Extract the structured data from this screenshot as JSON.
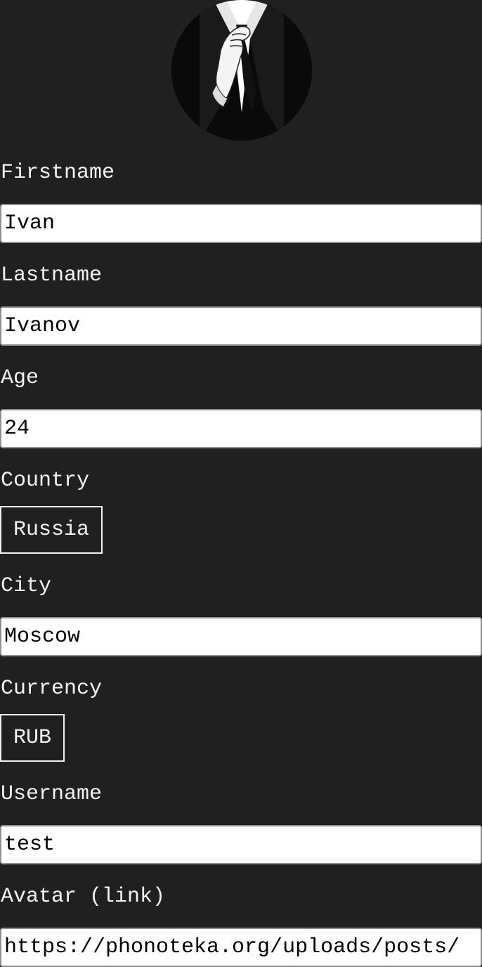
{
  "profile": {
    "avatar_icon": "anonymous-suit-avatar",
    "fields": {
      "firstname": {
        "label": "Firstname",
        "value": "Ivan"
      },
      "lastname": {
        "label": "Lastname",
        "value": "Ivanov"
      },
      "age": {
        "label": "Age",
        "value": "24"
      },
      "country": {
        "label": "Country",
        "value": "Russia"
      },
      "city": {
        "label": "City",
        "value": "Moscow"
      },
      "currency": {
        "label": "Currency",
        "value": "RUB"
      },
      "username": {
        "label": "Username",
        "value": "test"
      },
      "avatar_link": {
        "label": "Avatar (link)",
        "value": "https://phonoteka.org/uploads/posts/"
      }
    }
  },
  "colors": {
    "background": "#202020",
    "text": "#f2f2f2",
    "input_background": "#ffffff",
    "input_border": "#8f8f8f"
  }
}
